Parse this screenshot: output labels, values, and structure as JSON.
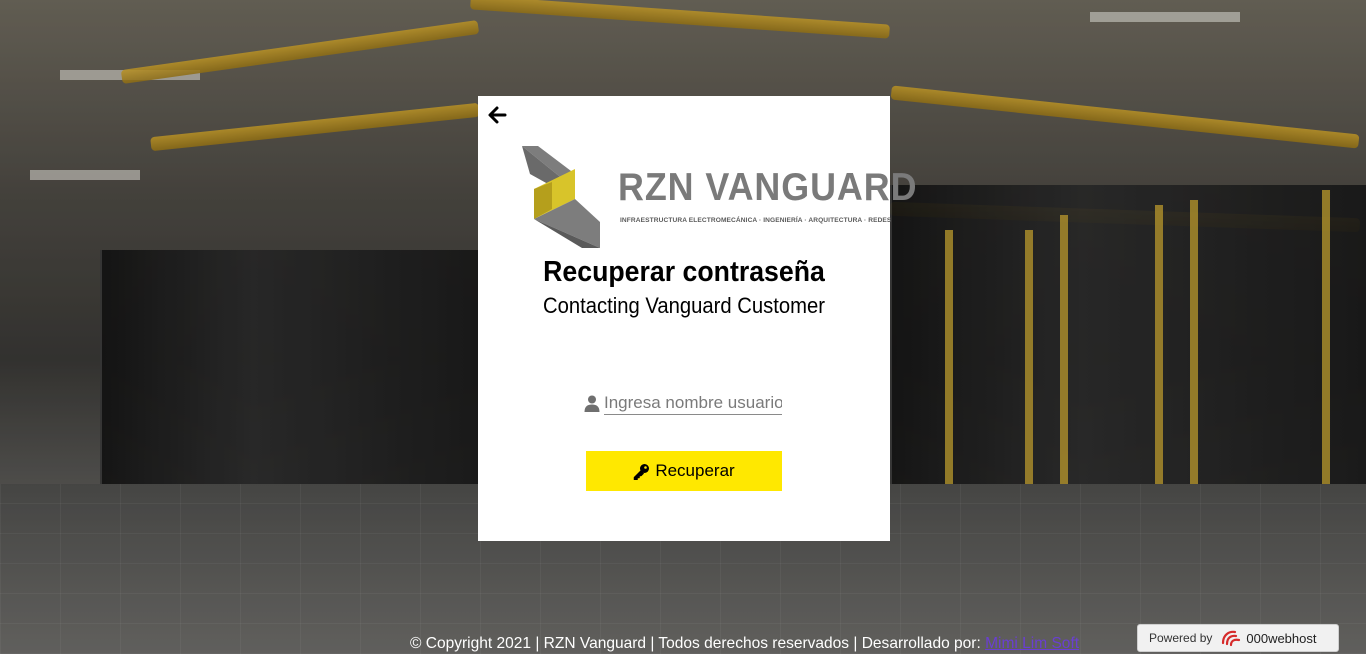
{
  "card": {
    "title": "Recuperar contraseña",
    "subtitle": "Contacting Vanguard Customer",
    "logo_name": "RZN VANGUARD",
    "logo_tagline": "INFRAESTRUCTURA ELECTROMECÁNICA · INGENIERÍA · ARQUITECTURA · REDES",
    "username_placeholder": "Ingresa nombre usuario",
    "username_value": "",
    "recover_button_label": "Recuperar"
  },
  "footer": {
    "text": "© Copyright 2021 | RZN Vanguard | Todos derechos reservados | Desarrollado por: ",
    "link_text": "Mimi Lim Soft"
  },
  "powered": {
    "label": "Powered by",
    "brand": "000webhost"
  },
  "colors": {
    "accent_yellow": "#ffe800",
    "logo_gray": "#7a7a7a",
    "link_purple": "#6a3fd1"
  },
  "icons": {
    "back": "arrow-left-icon",
    "user": "user-icon",
    "key": "key-icon",
    "host_logo": "000webhost-logo-icon"
  }
}
